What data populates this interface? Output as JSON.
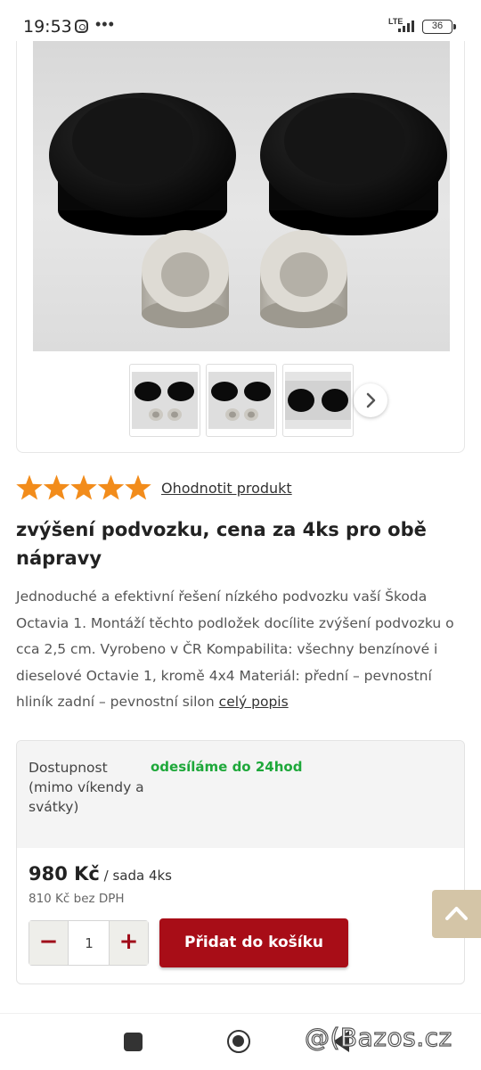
{
  "status_bar": {
    "time": "19:53",
    "more": "•••",
    "network": "LTE",
    "battery": "36"
  },
  "gallery": {
    "thumbnails": [
      "thumbnail-1",
      "thumbnail-2",
      "thumbnail-3"
    ],
    "next_icon": "chevron-right-icon"
  },
  "rating": {
    "stars": 5,
    "max_stars": 5,
    "star_color": "#f28c1b",
    "rate_link": "Ohodnotit produkt"
  },
  "product": {
    "title": "zvýšení podvozku, cena za 4ks pro obě nápravy",
    "description": "Jednoduché a efektivní řešení nízkého podvozku vaší Škoda Octavia 1. Montáží těchto podložek docílite zvýšení podvozku o cca 2,5 cm. Vyrobeno v ČR   Kompabilita: všechny benzínové i dieselové Octavie 1, kromě 4x4   Materiál: přední – pevnostní hliník zadní – pevnostní silon  ",
    "more_link": "celý popis"
  },
  "buy_box": {
    "availability_label": "Dostupnost (mimo víkendy a svátky)",
    "availability_value": "odesíláme do 24hod",
    "availability_color": "#1ea83a",
    "price": "980 Kč",
    "unit": " / sada 4ks",
    "price_net": "810 Kč bez DPH",
    "quantity": "1",
    "minus_label": "−",
    "plus_label": "+",
    "add_to_cart": "Přidat do košíku",
    "button_color": "#a80d17"
  },
  "watermark": "@(Bazos.cz"
}
